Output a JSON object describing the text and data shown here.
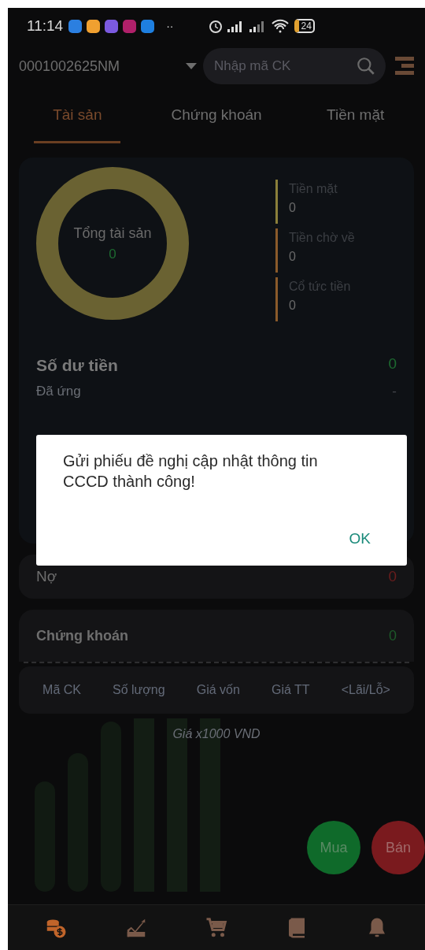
{
  "status_bar": {
    "time": "11:14",
    "notification_apps": [
      {
        "color": "#2b7fe0"
      },
      {
        "color": "#f0a030"
      },
      {
        "color": "#7b5ae0"
      },
      {
        "color": "#b0206a"
      },
      {
        "color": "#1e7fe0"
      }
    ],
    "more": "··",
    "battery": "24"
  },
  "header": {
    "account": "0001002625NM",
    "search": {
      "placeholder": "Nhập mã CK"
    }
  },
  "tabs": [
    {
      "label": "Tài sản",
      "selected": true
    },
    {
      "label": "Chứng khoán",
      "selected": false
    },
    {
      "label": "Tiền mặt",
      "selected": false
    }
  ],
  "summary": {
    "total_label": "Tổng tài sản",
    "total_value": "0",
    "legend": [
      {
        "label": "Tiền mặt",
        "value": "0",
        "color": "#8a7f3a"
      },
      {
        "label": "Tiền chờ về",
        "value": "0",
        "color": "#8a5a2a"
      },
      {
        "label": "Cổ tức tiền",
        "value": "0",
        "color": "#8a5a2a"
      }
    ],
    "balance": {
      "label": "Số dư tiền",
      "value": "0"
    },
    "advance": {
      "label": "Đã ứng",
      "value": "-"
    }
  },
  "debt": {
    "label": "Nợ",
    "value": "0"
  },
  "securities": {
    "label": "Chứng khoán",
    "value": "0",
    "columns": [
      "Mã CK",
      "Số lượng",
      "Giá vốn",
      "Giá TT",
      "<Lãi/Lỗ>"
    ],
    "note": "Giá x1000 VND"
  },
  "actions": [
    {
      "label": "Mua",
      "kind": "buy"
    },
    {
      "label": "Bán",
      "kind": "sell"
    }
  ],
  "bottom_nav": [
    {
      "kind": "coins",
      "selected": true
    },
    {
      "kind": "chart",
      "selected": false
    },
    {
      "kind": "cart",
      "selected": false
    },
    {
      "kind": "book",
      "selected": false
    },
    {
      "kind": "bell",
      "selected": false
    }
  ],
  "dialog": {
    "message": "Gửi phiếu đề nghị cập nhật thông tin CCCD thành công!",
    "button": "OK"
  }
}
